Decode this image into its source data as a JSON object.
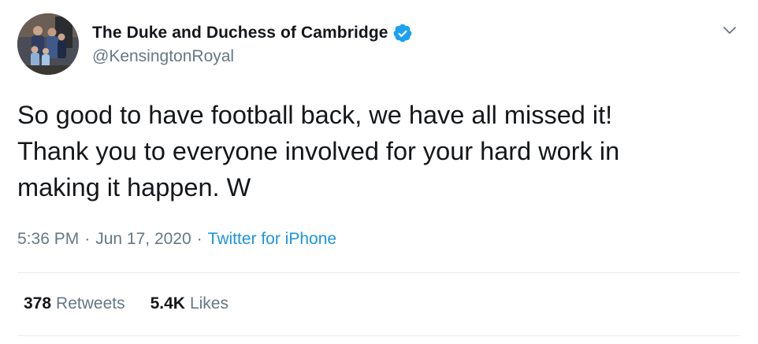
{
  "author": {
    "display_name": "The Duke and Duchess of Cambridge",
    "handle": "@KensingtonRoyal",
    "verified_icon": "verified-badge-icon",
    "avatar_alt": "profile photo"
  },
  "tweet": {
    "lines": [
      "So good to have football back, we have all missed it!",
      "Thank you to everyone involved for your hard work in",
      "making it happen. W"
    ]
  },
  "meta": {
    "time": "5:36 PM",
    "date": "Jun 17, 2020",
    "separator": "·",
    "source": "Twitter for iPhone"
  },
  "stats": {
    "retweets_count": "378",
    "retweets_label": "Retweets",
    "likes_count": "5.4K",
    "likes_label": "Likes"
  },
  "colors": {
    "accent": "#1b95e0",
    "verified": "#1da1f2",
    "secondary_text": "#657786",
    "primary_text": "#14171a",
    "divider": "#e6ecf0"
  }
}
